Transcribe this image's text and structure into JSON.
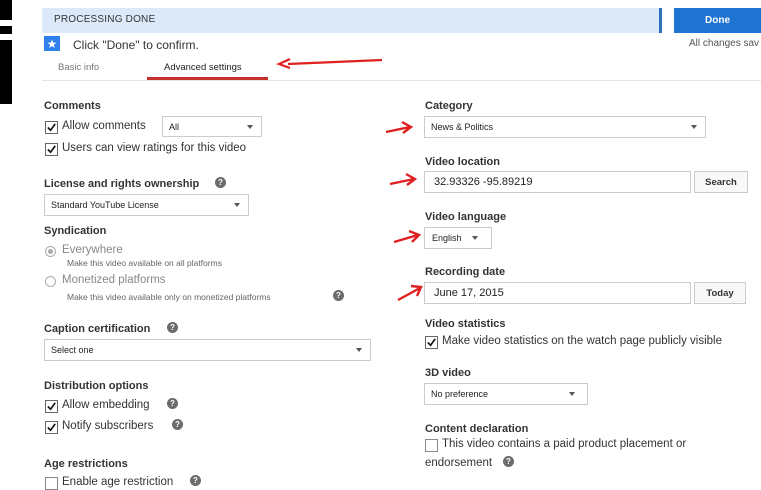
{
  "header": {
    "banner_text": "PROCESSING DONE",
    "done_label": "Done",
    "confirm_text": "Click \"Done\" to confirm.",
    "saved_text": "All changes sav"
  },
  "tabs": [
    {
      "label": "Basic info"
    },
    {
      "label": "Advanced settings"
    }
  ],
  "left": {
    "comments": {
      "heading": "Comments",
      "allow_label": "Allow comments",
      "allow_checked": true,
      "allow_select": "All",
      "ratings_label": "Users can view ratings for this video",
      "ratings_checked": true
    },
    "license": {
      "heading": "License and rights ownership",
      "value": "Standard YouTube License"
    },
    "syndication": {
      "heading": "Syndication",
      "everywhere_label": "Everywhere",
      "everywhere_desc": "Make this video available on all platforms",
      "monetized_label": "Monetized platforms",
      "monetized_desc": "Make this video available only on monetized platforms"
    },
    "caption": {
      "heading": "Caption certification",
      "value": "Select one"
    },
    "distribution": {
      "heading": "Distribution options",
      "embedding_label": "Allow embedding",
      "notify_label": "Notify subscribers"
    },
    "age": {
      "heading": "Age restrictions",
      "enable_label": "Enable age restriction"
    }
  },
  "right": {
    "category": {
      "heading": "Category",
      "value": "News & Politics"
    },
    "location": {
      "heading": "Video location",
      "value": "32.93326 -95.89219",
      "button": "Search"
    },
    "language": {
      "heading": "Video language",
      "value": "English"
    },
    "recording": {
      "heading": "Recording date",
      "value": "June 17, 2015",
      "button": "Today"
    },
    "statistics": {
      "heading": "Video statistics",
      "label": "Make video statistics on the watch page publicly visible"
    },
    "video3d": {
      "heading": "3D video",
      "value": "No preference"
    },
    "content": {
      "heading": "Content declaration",
      "label_line1": "This video contains a paid product placement or",
      "label_line2": "endorsement"
    }
  },
  "colors": {
    "accent_blue": "#1f73d2",
    "banner_bg": "#dbe9f8",
    "arrow_red": "#e02020",
    "tab_underline": "#c4302b"
  }
}
